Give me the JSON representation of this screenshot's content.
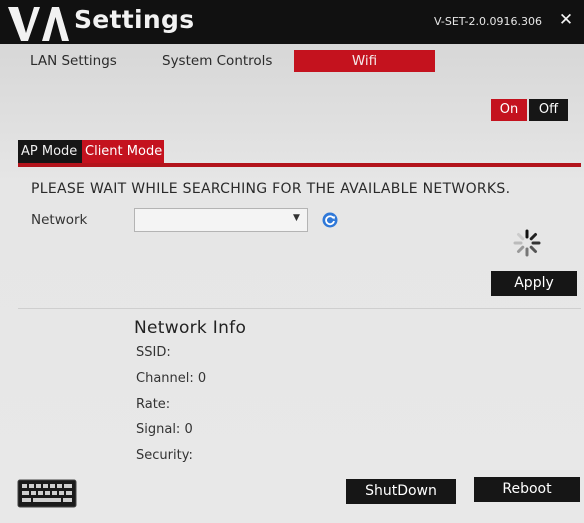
{
  "app": {
    "title": "Settings",
    "version": "V-SET-2.0.0916.306",
    "close_label": "✕"
  },
  "top_tabs": [
    {
      "label": "LAN Settings",
      "active": false
    },
    {
      "label": "System Controls",
      "active": false
    },
    {
      "label": "Wifi",
      "active": true
    }
  ],
  "wifi_toggle": {
    "on_label": "On",
    "off_label": "Off",
    "state": "on"
  },
  "mode_tabs": [
    {
      "label": "AP Mode",
      "active": false
    },
    {
      "label": "Client Mode",
      "active": true
    }
  ],
  "client_mode": {
    "status_message": "PLEASE WAIT WHILE SEARCHING FOR THE AVAILABLE NETWORKS.",
    "network_label": "Network",
    "network_value": "",
    "apply_label": "Apply"
  },
  "network_info": {
    "title": "Network Info",
    "ssid_label": "SSID:",
    "ssid_value": "",
    "channel_label": "Channel:",
    "channel_value": "0",
    "rate_label": "Rate:",
    "rate_value": "",
    "signal_label": "Signal:",
    "signal_value": "0",
    "security_label": "Security:",
    "security_value": ""
  },
  "footer": {
    "shutdown_label": "ShutDown",
    "reboot_label": "Reboot"
  },
  "colors": {
    "accent_red": "#c4121e",
    "button_black": "#161616",
    "refresh_blue": "#2f78d8"
  },
  "icons": {
    "logo": "va-logo",
    "close": "close-icon",
    "dropdown": "chevron-down-icon",
    "refresh": "refresh-icon",
    "loading": "spinner-icon",
    "keyboard": "keyboard-icon"
  }
}
